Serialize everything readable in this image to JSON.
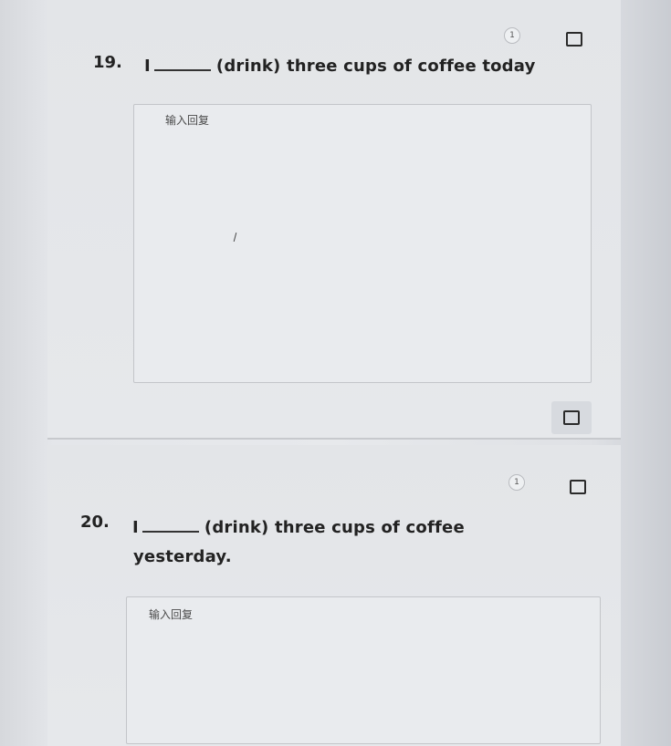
{
  "questions": [
    {
      "number": "19.",
      "subject": "I",
      "prompt": "(drink) three cups of coffee today",
      "score": "1",
      "answer_placeholder": "输入回复"
    },
    {
      "number": "20.",
      "subject": "I",
      "prompt_line1": "(drink) three cups of coffee",
      "prompt_line2": "yesterday.",
      "score": "1",
      "answer_placeholder": "输入回复"
    }
  ],
  "icons": {
    "score": "score-badge-icon",
    "bookmark": "bookmark-icon"
  }
}
